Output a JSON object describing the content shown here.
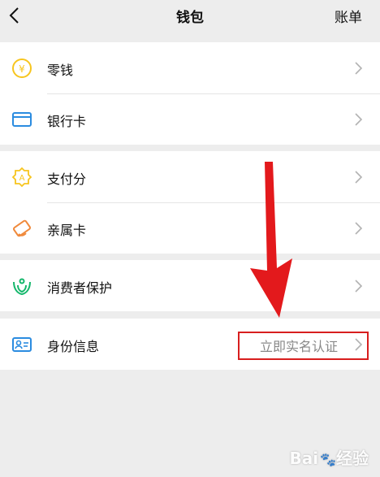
{
  "nav": {
    "title": "钱包",
    "action": "账单",
    "back_icon": "chevron-left-icon"
  },
  "groups": [
    {
      "items": [
        {
          "label": "零钱",
          "icon": "yen-coin-icon",
          "color": "#f7c51e"
        },
        {
          "label": "银行卡",
          "icon": "bank-card-icon",
          "color": "#2b8ce0"
        }
      ]
    },
    {
      "items": [
        {
          "label": "支付分",
          "icon": "pay-score-icon",
          "color": "#f7c51e"
        },
        {
          "label": "亲属卡",
          "icon": "family-card-icon",
          "color": "#f08a3c"
        }
      ]
    },
    {
      "items": [
        {
          "label": "消费者保护",
          "icon": "consumer-protection-icon",
          "color": "#15b76c"
        }
      ]
    },
    {
      "items": [
        {
          "label": "身份信息",
          "icon": "id-card-icon",
          "color": "#2b8ce0",
          "value": "立即实名认证"
        }
      ]
    }
  ],
  "annotation": {
    "arrow_color": "#e3191c",
    "box_color": "#d81e1e"
  },
  "watermark": {
    "text": "Bai",
    "suffix": "经验"
  }
}
